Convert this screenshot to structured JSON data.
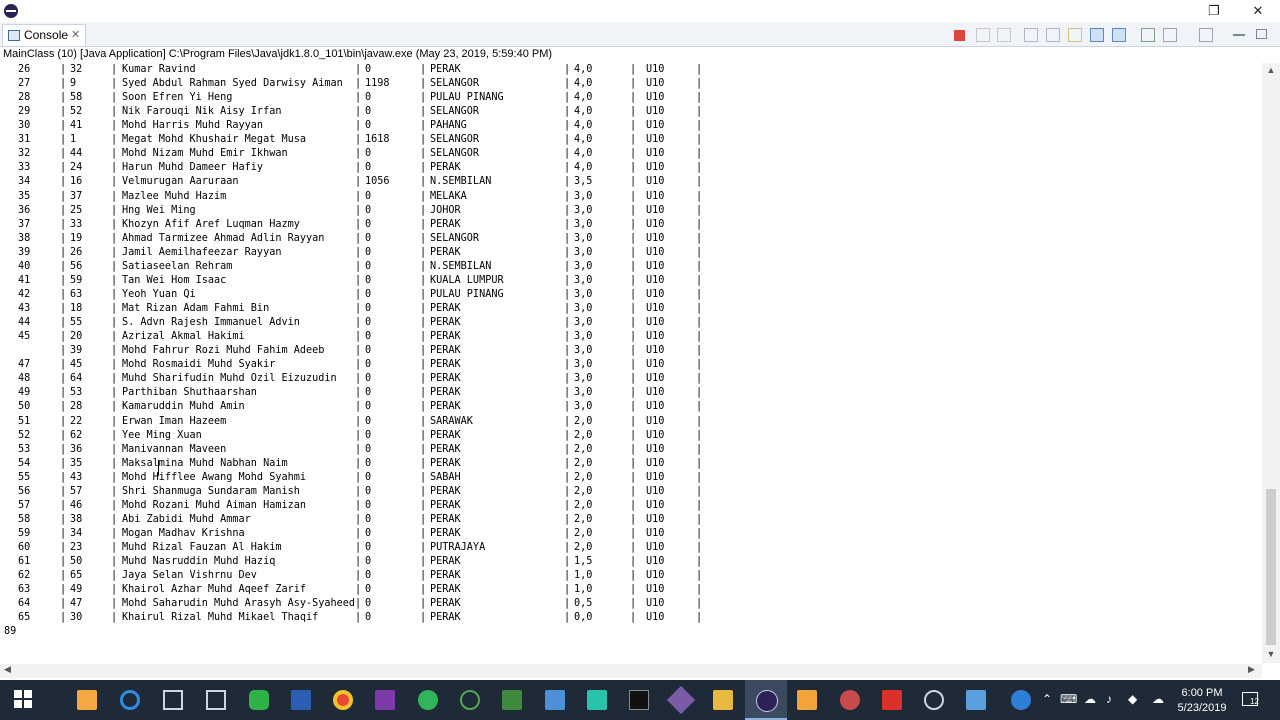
{
  "window": {
    "restore_glyph": "❐",
    "close_glyph": "✕"
  },
  "tab": {
    "label": "Console",
    "close_glyph": "✕"
  },
  "launch_info": "MainClass (10) [Java Application] C:\\Program Files\\Java\\jdk1.8.0_101\\bin\\javaw.exe (May 23, 2019, 5:59:40 PM)",
  "rows": [
    {
      "n": "26",
      "id": "32",
      "name": "Kumar Ravind",
      "rating": "0",
      "state": "PERAK",
      "points": "4,0",
      "cat": "U10"
    },
    {
      "n": "27",
      "id": "9",
      "name": "Syed Abdul Rahman Syed Darwisy Aiman",
      "rating": "1198",
      "state": "SELANGOR",
      "points": "4,0",
      "cat": "U10"
    },
    {
      "n": "28",
      "id": "58",
      "name": "Soon Efren Yi Heng",
      "rating": "0",
      "state": "PULAU PINANG",
      "points": "4,0",
      "cat": "U10"
    },
    {
      "n": "29",
      "id": "52",
      "name": "Nik Farouqi Nik Aisy Irfan",
      "rating": "0",
      "state": "SELANGOR",
      "points": "4,0",
      "cat": "U10"
    },
    {
      "n": "30",
      "id": "41",
      "name": "Mohd Harris Muhd Rayyan",
      "rating": "0",
      "state": "PAHANG",
      "points": "4,0",
      "cat": "U10"
    },
    {
      "n": "31",
      "id": "1",
      "name": "Megat Mohd Khushair Megat Musa",
      "rating": "1618",
      "state": "SELANGOR",
      "points": "4,0",
      "cat": "U10"
    },
    {
      "n": "32",
      "id": "44",
      "name": "Mohd Nizam Muhd Emir Ikhwan",
      "rating": "0",
      "state": "SELANGOR",
      "points": "4,0",
      "cat": "U10"
    },
    {
      "n": "33",
      "id": "24",
      "name": "Harun Muhd Dameer Hafiy",
      "rating": "0",
      "state": "PERAK",
      "points": "4,0",
      "cat": "U10"
    },
    {
      "n": "34",
      "id": "16",
      "name": "Velmurugan Aaruraan",
      "rating": "1056",
      "state": "N.SEMBILAN",
      "points": "3,5",
      "cat": "U10"
    },
    {
      "n": "35",
      "id": "37",
      "name": "Mazlee Muhd Hazim",
      "rating": "0",
      "state": "MELAKA",
      "points": "3,0",
      "cat": "U10"
    },
    {
      "n": "36",
      "id": "25",
      "name": "Hng Wei Ming",
      "rating": "0",
      "state": "JOHOR",
      "points": "3,0",
      "cat": "U10"
    },
    {
      "n": "37",
      "id": "33",
      "name": "Khozyn Afif Aref Luqman Hazmy",
      "rating": "0",
      "state": "PERAK",
      "points": "3,0",
      "cat": "U10"
    },
    {
      "n": "38",
      "id": "19",
      "name": "Ahmad Tarmizee Ahmad Adlin Rayyan",
      "rating": "0",
      "state": "SELANGOR",
      "points": "3,0",
      "cat": "U10"
    },
    {
      "n": "39",
      "id": "26",
      "name": "Jamil Aemilhafeezar Rayyan",
      "rating": "0",
      "state": "PERAK",
      "points": "3,0",
      "cat": "U10"
    },
    {
      "n": "40",
      "id": "56",
      "name": "Satiaseelan Rehram",
      "rating": "0",
      "state": "N.SEMBILAN",
      "points": "3,0",
      "cat": "U10"
    },
    {
      "n": "41",
      "id": "59",
      "name": "Tan Wei Hom Isaac",
      "rating": "0",
      "state": "KUALA LUMPUR",
      "points": "3,0",
      "cat": "U10"
    },
    {
      "n": "42",
      "id": "63",
      "name": "Yeoh Yuan Qi",
      "rating": "0",
      "state": "PULAU PINANG",
      "points": "3,0",
      "cat": "U10"
    },
    {
      "n": "43",
      "id": "18",
      "name": "Mat Rizan Adam Fahmi Bin",
      "rating": "0",
      "state": "PERAK",
      "points": "3,0",
      "cat": "U10"
    },
    {
      "n": "44",
      "id": "55",
      "name": "S. Advn Rajesh Immanuel Advin",
      "rating": "0",
      "state": "PERAK",
      "points": "3,0",
      "cat": "U10"
    },
    {
      "n": "45",
      "id": "20",
      "name": "Azrizal Akmal Hakimi",
      "rating": "0",
      "state": "PERAK",
      "points": "3,0",
      "cat": "U10"
    },
    {
      "n": "",
      "id": "39",
      "name": "Mohd Fahrur Rozi Muhd Fahim Adeeb",
      "rating": "0",
      "state": "PERAK",
      "points": "3,0",
      "cat": "U10"
    },
    {
      "n": "47",
      "id": "45",
      "name": "Mohd Rosmaidi Muhd Syakir",
      "rating": "0",
      "state": "PERAK",
      "points": "3,0",
      "cat": "U10"
    },
    {
      "n": "48",
      "id": "64",
      "name": "Muhd Sharifudin Muhd Ozil Eizuzudin",
      "rating": "0",
      "state": "PERAK",
      "points": "3,0",
      "cat": "U10"
    },
    {
      "n": "49",
      "id": "53",
      "name": "Parthiban Shuthaarshan",
      "rating": "0",
      "state": "PERAK",
      "points": "3,0",
      "cat": "U10"
    },
    {
      "n": "50",
      "id": "28",
      "name": "Kamaruddin Muhd Amin",
      "rating": "0",
      "state": "PERAK",
      "points": "3,0",
      "cat": "U10"
    },
    {
      "n": "51",
      "id": "22",
      "name": "Erwan Iman Hazeem",
      "rating": "0",
      "state": "SARAWAK",
      "points": "2,0",
      "cat": "U10"
    },
    {
      "n": "52",
      "id": "62",
      "name": "Yee Ming Xuan",
      "rating": "0",
      "state": "PERAK",
      "points": "2,0",
      "cat": "U10"
    },
    {
      "n": "53",
      "id": "36",
      "name": "Manivannan Maveen",
      "rating": "0",
      "state": "PERAK",
      "points": "2,0",
      "cat": "U10"
    },
    {
      "n": "54",
      "id": "35",
      "name": "Maksalmina Muhd Nabhan Naim",
      "rating": "0",
      "state": "PERAK",
      "points": "2,0",
      "cat": "U10"
    },
    {
      "n": "55",
      "id": "43",
      "name": "Mohd Hifflee Awang Mohd Syahmi",
      "rating": "0",
      "state": "SABAH",
      "points": "2,0",
      "cat": "U10"
    },
    {
      "n": "56",
      "id": "57",
      "name": "Shri Shanmuga Sundaram Manish",
      "rating": "0",
      "state": "PERAK",
      "points": "2,0",
      "cat": "U10"
    },
    {
      "n": "57",
      "id": "46",
      "name": "Mohd Rozani Muhd Aiman Hamizan",
      "rating": "0",
      "state": "PERAK",
      "points": "2,0",
      "cat": "U10"
    },
    {
      "n": "58",
      "id": "38",
      "name": "Abi Zabidi Muhd Ammar",
      "rating": "0",
      "state": "PERAK",
      "points": "2,0",
      "cat": "U10"
    },
    {
      "n": "59",
      "id": "34",
      "name": "Mogan Madhav Krishna",
      "rating": "0",
      "state": "PERAK",
      "points": "2,0",
      "cat": "U10"
    },
    {
      "n": "60",
      "id": "23",
      "name": "Muhd Rizal Fauzan Al Hakim",
      "rating": "0",
      "state": "PUTRAJAYA",
      "points": "2,0",
      "cat": "U10"
    },
    {
      "n": "61",
      "id": "50",
      "name": "Muhd Nasruddin Muhd Haziq",
      "rating": "0",
      "state": "PERAK",
      "points": "1,5",
      "cat": "U10"
    },
    {
      "n": "62",
      "id": "65",
      "name": "Jaya Selan Vishrnu Dev",
      "rating": "0",
      "state": "PERAK",
      "points": "1,0",
      "cat": "U10"
    },
    {
      "n": "63",
      "id": "49",
      "name": "Khairol Azhar Muhd Aqeef Zarif",
      "rating": "0",
      "state": "PERAK",
      "points": "1,0",
      "cat": "U10"
    },
    {
      "n": "64",
      "id": "47",
      "name": "Mohd Saharudin Muhd Arasyh Asy-Syaheed",
      "rating": "0",
      "state": "PERAK",
      "points": "0,5",
      "cat": "U10"
    },
    {
      "n": "65",
      "id": "30",
      "name": "Khairul Rizal Muhd Mikael Thaqif",
      "rating": "0",
      "state": "PERAK",
      "points": "0,0",
      "cat": "U10"
    }
  ],
  "final_output": "89",
  "clock": {
    "time": "6:00 PM",
    "date": "5/23/2019"
  },
  "tray": {
    "notification_count": "12"
  },
  "colors": {
    "taskbar": "#1e2a38",
    "tab_bg": "#f0f3f8",
    "terminate_red": "#e0443e"
  }
}
